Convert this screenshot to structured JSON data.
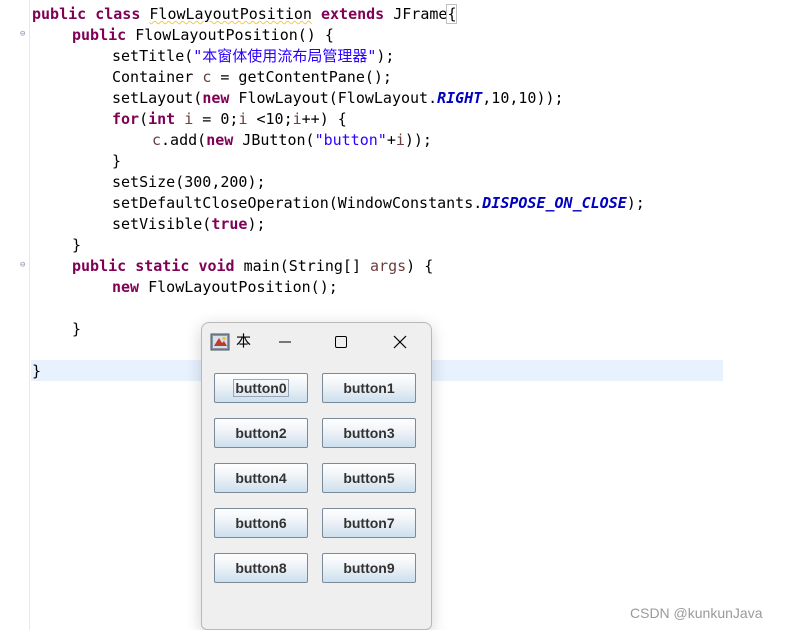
{
  "editor": {
    "lines": {
      "l1": {
        "kw1": "public",
        "kw2": "class",
        "name": "FlowLayoutPosition",
        "kw3": "extends",
        "sup": "JFrame",
        "brace": "{"
      },
      "l2": {
        "kw1": "public",
        "rest": "FlowLayoutPosition() {"
      },
      "l3": {
        "a": "setTitle(",
        "str": "\"本窗体使用流布局管理器\"",
        "b": ");"
      },
      "l4": {
        "a": "Container ",
        "var": "c",
        "b": " = getContentPane();"
      },
      "l5": {
        "a": "setLayout(",
        "kw": "new",
        "b": " FlowLayout(FlowLayout.",
        "const": "RIGHT",
        "c": ",10,10));"
      },
      "l6": {
        "kw1": "for",
        "a": "(",
        "kw2": "int",
        "b": " ",
        "v1": "i",
        "c": " = 0;",
        "v2": "i",
        "d": " <10;",
        "v3": "i",
        "e": "++) {"
      },
      "l7": {
        "var": "c",
        "a": ".add(",
        "kw": "new",
        "b": " JButton(",
        "str": "\"button\"",
        "c": "+",
        "v": "i",
        "d": "));"
      },
      "l8": {
        "text": "}"
      },
      "l9": {
        "text": "setSize(300,200);"
      },
      "l10": {
        "a": "setDefaultCloseOperation(WindowConstants.",
        "const": "DISPOSE_ON_CLOSE",
        "b": ");"
      },
      "l11": {
        "a": "setVisible(",
        "kw": "true",
        "b": ");"
      },
      "l12": {
        "text": "}"
      },
      "l13": {
        "kw1": "public",
        "kw2": "static",
        "kw3": "void",
        "a": " main(String[] ",
        "arg": "args",
        "b": ") {"
      },
      "l14": {
        "kw": "new",
        "a": " FlowLayoutPosition();"
      },
      "l16": {
        "text": "}"
      },
      "l18": {
        "text": "}"
      }
    },
    "fold_marker": "⊖"
  },
  "window": {
    "title": "本",
    "buttons": [
      "button0",
      "button1",
      "button2",
      "button3",
      "button4",
      "button5",
      "button6",
      "button7",
      "button8",
      "button9"
    ]
  },
  "watermark": "CSDN @kunkunJava",
  "colors": {
    "keyword": "#7f0055",
    "string": "#2a00ff",
    "constant": "#0000c0",
    "local": "#6a3e3e",
    "current_line": "#e8f2fe"
  }
}
